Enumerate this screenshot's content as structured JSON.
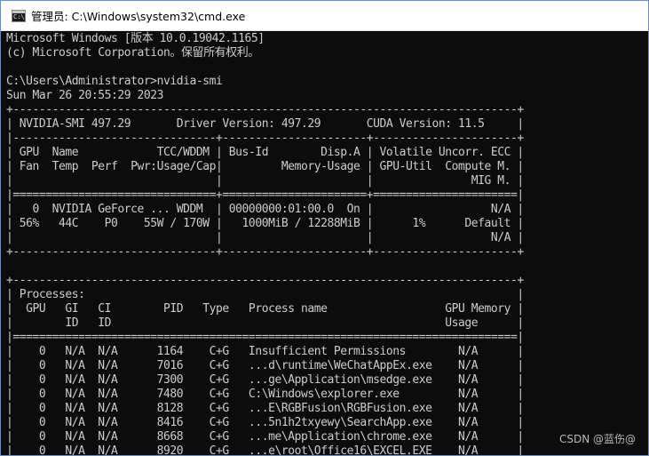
{
  "window": {
    "title": "管理员: C:\\Windows\\system32\\cmd.exe"
  },
  "terminal": {
    "lines": [
      "Microsoft Windows [版本 10.0.19042.1165]",
      "(c) Microsoft Corporation。保留所有权利。",
      "",
      "C:\\Users\\Administrator>nvidia-smi",
      "Sun Mar 26 20:55:29 2023",
      "+-----------------------------------------------------------------------------+",
      "| NVIDIA-SMI 497.29       Driver Version: 497.29       CUDA Version: 11.5     |",
      "|-------------------------------+----------------------+----------------------+",
      "| GPU  Name            TCC/WDDM | Bus-Id        Disp.A | Volatile Uncorr. ECC |",
      "| Fan  Temp  Perf  Pwr:Usage/Cap|         Memory-Usage | GPU-Util  Compute M. |",
      "|                               |                      |               MIG M. |",
      "|===============================+======================+======================|",
      "|   0  NVIDIA GeForce ... WDDM  | 00000000:01:00.0  On |                  N/A |",
      "| 56%   44C    P0    55W / 170W |   1000MiB / 12288MiB |      1%      Default |",
      "|                               |                      |                  N/A |",
      "+-------------------------------+----------------------+----------------------+",
      "",
      "+-----------------------------------------------------------------------------+",
      "| Processes:                                                                  |",
      "|  GPU   GI   CI        PID   Type   Process name                  GPU Memory |",
      "|        ID   ID                                                   Usage      |",
      "|=============================================================================|",
      "|    0   N/A  N/A      1164    C+G   Insufficient Permissions        N/A      |",
      "|    0   N/A  N/A      7016    C+G   ...d\\runtime\\WeChatAppEx.exe    N/A      |",
      "|    0   N/A  N/A      7300    C+G   ...ge\\Application\\msedge.exe    N/A      |",
      "|    0   N/A  N/A      7480    C+G   C:\\Windows\\explorer.exe         N/A      |",
      "|    0   N/A  N/A      8128    C+G   ...E\\RGBFusion\\RGBFusion.exe    N/A      |",
      "|    0   N/A  N/A      8416    C+G   ...5n1h2txyewy\\SearchApp.exe    N/A      |",
      "|    0   N/A  N/A      8668    C+G   ...me\\Application\\chrome.exe    N/A      |",
      "|    0   N/A  N/A      8920    C+G   ...e\\root\\Office16\\EXCEL.EXE    N/A      |"
    ]
  },
  "watermark": {
    "text": "CSDN @蓝伤@"
  }
}
